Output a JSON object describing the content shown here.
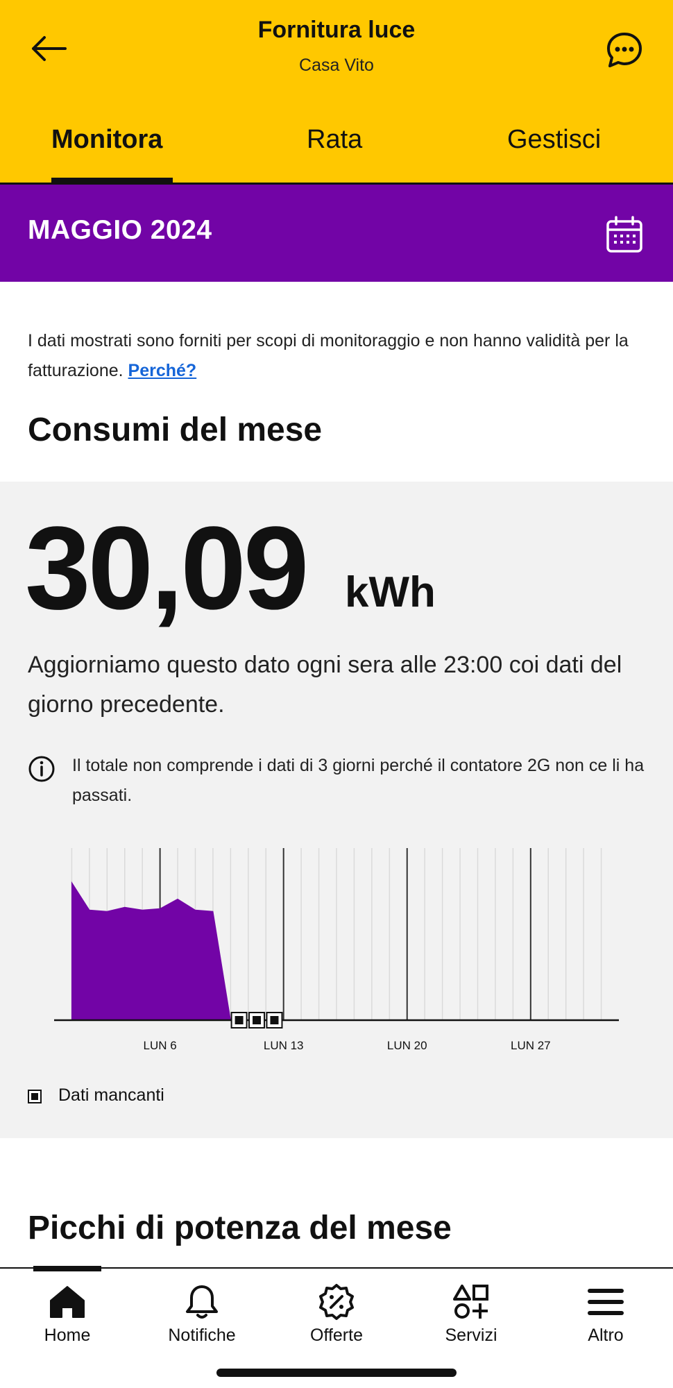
{
  "header": {
    "title": "Fornitura luce",
    "subtitle": "Casa Vito",
    "background": "#FFC800",
    "icons": {
      "back": "arrow-left-icon",
      "chat": "chat-bubble-icon"
    }
  },
  "tabs": [
    {
      "label": "Monitora",
      "active": true
    },
    {
      "label": "Rata",
      "active": false
    },
    {
      "label": "Gestisci",
      "active": false
    }
  ],
  "month_bar": {
    "label": "MAGGIO 2024",
    "background": "#7204A6",
    "icon": "calendar-icon"
  },
  "disclaimer": {
    "text": "I dati mostrati sono forniti per scopi di monitoraggio e non hanno validità per la fatturazione.",
    "link": "Perché?"
  },
  "consumption": {
    "section_title": "Consumi del mese",
    "value": "30,09",
    "unit": "kWh",
    "update_note": "Aggiorniamo questo dato ogni sera alle 23:00 coi dati del giorno precedente.",
    "info": "Il totale non comprende i dati di 3 giorni perché il contatore 2G non ce li ha passati."
  },
  "chart_data": {
    "type": "area",
    "color": "#7204A6",
    "x_tick_labels": [
      "LUN 6",
      "LUN 13",
      "LUN 20",
      "LUN 27"
    ],
    "x_ticks": [
      6,
      13,
      20,
      27
    ],
    "xlim": [
      0,
      32
    ],
    "ylim": [
      0,
      1.25
    ],
    "x": [
      1,
      2,
      3,
      4,
      5,
      6,
      7,
      8,
      9,
      10
    ],
    "values": [
      1.0,
      0.8,
      0.79,
      0.82,
      0.8,
      0.81,
      0.88,
      0.8,
      0.79,
      0.0
    ],
    "missing_days": [
      10,
      11,
      12
    ],
    "grid": true,
    "legend_label": "Dati mancanti"
  },
  "peaks": {
    "section_title": "Picchi di potenza del mese"
  },
  "bottom_nav": [
    {
      "label": "Home",
      "icon": "home-icon",
      "active": true
    },
    {
      "label": "Notifiche",
      "icon": "bell-icon",
      "active": false
    },
    {
      "label": "Offerte",
      "icon": "discount-badge-icon",
      "active": false
    },
    {
      "label": "Servizi",
      "icon": "shapes-icon",
      "active": false
    },
    {
      "label": "Altro",
      "icon": "menu-icon",
      "active": false
    }
  ]
}
